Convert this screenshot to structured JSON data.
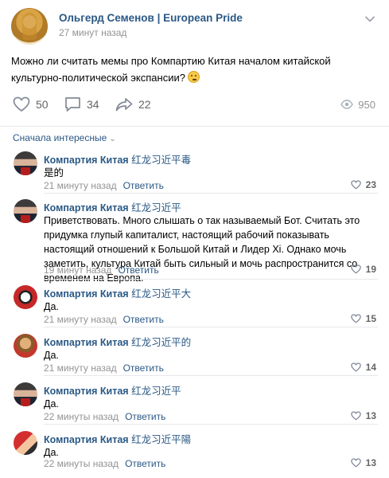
{
  "post": {
    "author": "Ольгерд Семенов | European Pride",
    "time": "27 минут назад",
    "text": "Можно ли считать мемы про Компартию Китая началом китайской культурно-политической экспансии?",
    "likes": "50",
    "comments": "34",
    "shares": "22",
    "views": "950"
  },
  "sort_label": "Сначала интересные",
  "reply_label": "Ответить",
  "comments": [
    {
      "name": "Компартия Китая",
      "suffix": "红龙习近平毒",
      "text": "是的",
      "time": "21 минуту назад",
      "likes": "23"
    },
    {
      "name": "Компартия Китая",
      "suffix": "红龙习近平",
      "text": "Приветствовать. Много слышать о так называемый Бот. Считать это придумка глупый капиталист, настоящий рабочий показывать настоящий отношений к Большой Китай и Лидер Xi. Однако мочь заметить, культура Китай быть сильный и мочь распространится со временем на Европа.",
      "time": "19 минут назад",
      "likes": "19"
    },
    {
      "name": "Компартия Китая",
      "suffix": "红龙习近平大",
      "text": "Да.",
      "time": "21 минуту назад",
      "likes": "15"
    },
    {
      "name": "Компартия Китая",
      "suffix": "红龙习近平的",
      "text": "Да.",
      "time": "21 минуту назад",
      "likes": "14"
    },
    {
      "name": "Компартия Китая",
      "suffix": "红龙习近平",
      "text": "Да.",
      "time": "22 минуты назад",
      "likes": "13"
    },
    {
      "name": "Компартия Китая",
      "suffix": "红龙习近平陽",
      "text": "Да.",
      "time": "22 минуты назад",
      "likes": "13"
    }
  ],
  "colors": {
    "link": "#2a5885",
    "muted": "#939393",
    "divider": "#e7e8ec"
  },
  "icons": [
    "heart-icon",
    "comment-icon",
    "share-icon",
    "eye-icon",
    "chevron-down-icon"
  ]
}
